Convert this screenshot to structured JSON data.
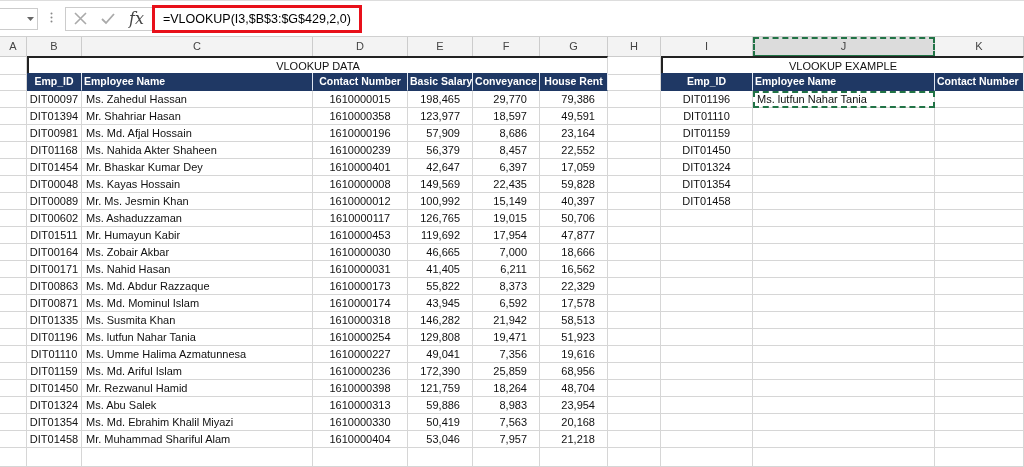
{
  "formula_bar": {
    "function_label": "fx",
    "formula": "=VLOOKUP(I3,$B$3:$G$429,2,0)",
    "highlighted": true
  },
  "columns": [
    {
      "letter": "A",
      "selected": false
    },
    {
      "letter": "B",
      "selected": false
    },
    {
      "letter": "C",
      "selected": false
    },
    {
      "letter": "D",
      "selected": false
    },
    {
      "letter": "E",
      "selected": false
    },
    {
      "letter": "F",
      "selected": false
    },
    {
      "letter": "G",
      "selected": false
    },
    {
      "letter": "H",
      "selected": false
    },
    {
      "letter": "I",
      "selected": false
    },
    {
      "letter": "J",
      "selected": true
    },
    {
      "letter": "K",
      "selected": false
    }
  ],
  "data_table": {
    "title": "VLOOKUP DATA",
    "columns": [
      "Emp_ID",
      "Employee Name",
      "Contact Number",
      "Basic Salary",
      "Conveyance",
      "House Rent"
    ],
    "rows": [
      [
        "DIT00097",
        "Ms. Zahedul Hassan",
        "1610000015",
        "198,465",
        "29,770",
        "79,386"
      ],
      [
        "DIT01394",
        "Mr. Shahriar Hasan",
        "1610000358",
        "123,977",
        "18,597",
        "49,591"
      ],
      [
        "DIT00981",
        "Ms. Md. Afjal Hossain",
        "1610000196",
        "57,909",
        "8,686",
        "23,164"
      ],
      [
        "DIT01168",
        "Ms. Nahida Akter Shaheen",
        "1610000239",
        "56,379",
        "8,457",
        "22,552"
      ],
      [
        "DIT01454",
        "Mr. Bhaskar Kumar Dey",
        "1610000401",
        "42,647",
        "6,397",
        "17,059"
      ],
      [
        "DIT00048",
        "Ms. Kayas Hossain",
        "1610000008",
        "149,569",
        "22,435",
        "59,828"
      ],
      [
        "DIT00089",
        "Mr. Ms. Jesmin Khan",
        "1610000012",
        "100,992",
        "15,149",
        "40,397"
      ],
      [
        "DIT00602",
        "Ms. Ashaduzzaman",
        "1610000117",
        "126,765",
        "19,015",
        "50,706"
      ],
      [
        "DIT01511",
        "Mr. Humayun Kabir",
        "1610000453",
        "119,692",
        "17,954",
        "47,877"
      ],
      [
        "DIT00164",
        "Ms. Zobair Akbar",
        "1610000030",
        "46,665",
        "7,000",
        "18,666"
      ],
      [
        "DIT00171",
        "Ms. Nahid Hasan",
        "1610000031",
        "41,405",
        "6,211",
        "16,562"
      ],
      [
        "DIT00863",
        "Ms. Md. Abdur Razzaque",
        "1610000173",
        "55,822",
        "8,373",
        "22,329"
      ],
      [
        "DIT00871",
        "Ms. Md. Mominul Islam",
        "1610000174",
        "43,945",
        "6,592",
        "17,578"
      ],
      [
        "DIT01335",
        "Ms. Susmita Khan",
        "1610000318",
        "146,282",
        "21,942",
        "58,513"
      ],
      [
        "DIT01196",
        "Ms. lutfun Nahar Tania",
        "1610000254",
        "129,808",
        "19,471",
        "51,923"
      ],
      [
        "DIT01110",
        "Ms. Umme Halima Azmatunnesa",
        "1610000227",
        "49,041",
        "7,356",
        "19,616"
      ],
      [
        "DIT01159",
        "Ms. Md. Ariful Islam",
        "1610000236",
        "172,390",
        "25,859",
        "68,956"
      ],
      [
        "DIT01450",
        "Mr. Rezwanul Hamid",
        "1610000398",
        "121,759",
        "18,264",
        "48,704"
      ],
      [
        "DIT01324",
        "Ms. Abu Salek",
        "1610000313",
        "59,886",
        "8,983",
        "23,954"
      ],
      [
        "DIT01354",
        "Ms. Md. Ebrahim Khalil Miyazi",
        "1610000330",
        "50,419",
        "7,563",
        "20,168"
      ],
      [
        "DIT01458",
        "Mr. Muhammad Shariful Alam",
        "1610000404",
        "53,046",
        "7,957",
        "21,218"
      ]
    ]
  },
  "example_table": {
    "title": "VLOOKUP EXAMPLE",
    "columns": [
      "Emp_ID",
      "Employee Name",
      "Contact Number"
    ],
    "rows": [
      {
        "emp_id": "DIT01196",
        "employee_name": "Ms. lutfun Nahar Tania",
        "selected": true
      },
      {
        "emp_id": "DIT01110",
        "selected": false
      },
      {
        "emp_id": "DIT01159",
        "selected": false
      },
      {
        "emp_id": "DIT01450",
        "selected": false
      },
      {
        "emp_id": "DIT01324",
        "selected": false
      },
      {
        "emp_id": "DIT01354",
        "selected": false
      },
      {
        "emp_id": "DIT01458",
        "selected": false
      }
    ]
  }
}
